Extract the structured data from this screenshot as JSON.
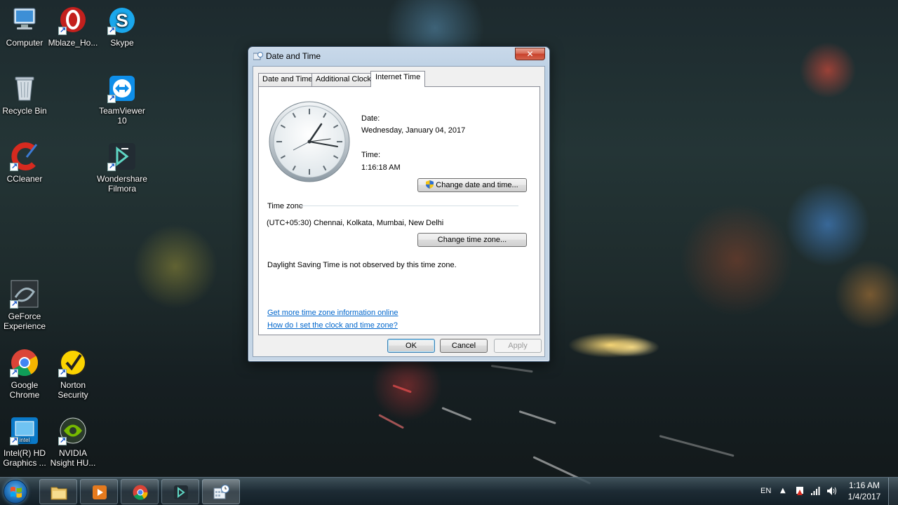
{
  "desktop": {
    "icons": [
      {
        "label": "Computer",
        "icon": "computer-icon"
      },
      {
        "label": "Mblaze_Ho...",
        "icon": "mblaze-icon"
      },
      {
        "label": "Skype",
        "icon": "skype-icon"
      },
      {
        "label": "Recycle Bin",
        "icon": "recycle-bin-icon"
      },
      {
        "label": "TeamViewer\n10",
        "icon": "teamviewer-icon"
      },
      {
        "label": "CCleaner",
        "icon": "ccleaner-icon"
      },
      {
        "label": "Wondershare\nFilmora",
        "icon": "filmora-icon"
      },
      {
        "label": "GeForce\nExperience",
        "icon": "geforce-icon"
      },
      {
        "label": "Google\nChrome",
        "icon": "chrome-icon"
      },
      {
        "label": "Norton\nSecurity",
        "icon": "norton-icon"
      },
      {
        "label": "Intel(R) HD\nGraphics ...",
        "icon": "intel-graphics-icon"
      },
      {
        "label": "NVIDIA\nNsight HU...",
        "icon": "nvidia-nsight-icon"
      }
    ]
  },
  "dialog": {
    "title": "Date and Time",
    "close_label": "✕",
    "tabs": [
      "Date and Time",
      "Additional Clocks",
      "Internet Time"
    ],
    "date_label": "Date:",
    "date_value": "Wednesday, January 04, 2017",
    "time_label": "Time:",
    "time_value": "1:16:18 AM",
    "change_date_button": "Change date and time...",
    "timezone_heading": "Time zone",
    "timezone_value": "(UTC+05:30) Chennai, Kolkata, Mumbai, New Delhi",
    "change_timezone_button": "Change time zone...",
    "dst_note": "Daylight Saving Time is not observed by this time zone.",
    "link_more_info": "Get more time zone information online",
    "link_how_to": "How do I set the clock and time zone?",
    "ok_button": "OK",
    "cancel_button": "Cancel",
    "apply_button": "Apply"
  },
  "taskbar": {
    "pinned": [
      "explorer-icon",
      "media-player-icon",
      "chrome-icon",
      "filmora-icon",
      "date-time-icon"
    ],
    "language": "EN",
    "clock_time": "1:16 AM",
    "clock_date": "1/4/2017"
  },
  "colors": {
    "link": "#0066cc",
    "accent": "#3c7fb1"
  }
}
